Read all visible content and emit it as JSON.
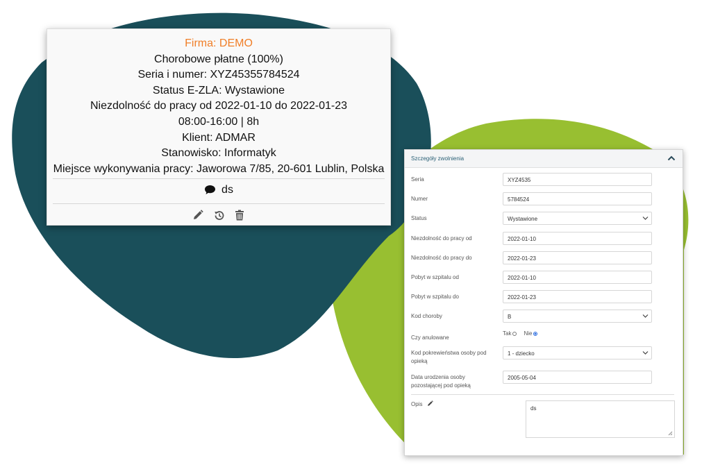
{
  "colors": {
    "teal_blob": "#1a4f5a",
    "green_blob": "#98bf31",
    "company_accent": "#f07f28",
    "header_title": "#2a6076"
  },
  "summary": {
    "company": "Firma: DEMO",
    "type": "Chorobowe płatne (100%)",
    "series_number": "Seria i numer: XYZ45355784524",
    "status": "Status E-ZLA: Wystawione",
    "period": "Niezdolność do pracy od 2022-01-10 do 2022-01-23",
    "hours": "08:00-16:00 | 8h",
    "client": "Klient: ADMAR",
    "position": "Stanowisko: Informatyk",
    "workplace": "Miejsce wykonywania pracy: Jaworowa 7/85, 20-601 Lublin, Polska",
    "comment": "ds",
    "icons": [
      "comment-icon",
      "edit-icon",
      "history-icon",
      "trash-icon"
    ]
  },
  "details": {
    "title": "Szczegóły zwolnienia",
    "fields": [
      {
        "label": "Seria",
        "value": "XYZ4535",
        "kind": "text"
      },
      {
        "label": "Numer",
        "value": "5784524",
        "kind": "text"
      },
      {
        "label": "Status",
        "value": "Wystawione",
        "kind": "select"
      },
      {
        "label": "Niezdolność do pracy od",
        "value": "2022-01-10",
        "kind": "text"
      },
      {
        "label": "Niezdolność do pracy do",
        "value": "2022-01-23",
        "kind": "text"
      },
      {
        "label": "Pobyt w szpitalu od",
        "value": "2022-01-10",
        "kind": "text"
      },
      {
        "label": "Pobyt w szpitalu do",
        "value": "2022-01-23",
        "kind": "text"
      },
      {
        "label": "Kod choroby",
        "value": "B",
        "kind": "select"
      }
    ],
    "cancelled": {
      "label": "Czy anulowane",
      "yes": "Tak",
      "no": "Nie",
      "selected": "Nie"
    },
    "relation": {
      "label": "Kod pokrewieństwa osoby pod opieką",
      "value": "1 - dziecko"
    },
    "birthdate": {
      "label": "Data urodzenia osoby pozostającej pod opieką",
      "value": "2005-05-04"
    },
    "description": {
      "label": "Opis",
      "value": "ds"
    }
  }
}
